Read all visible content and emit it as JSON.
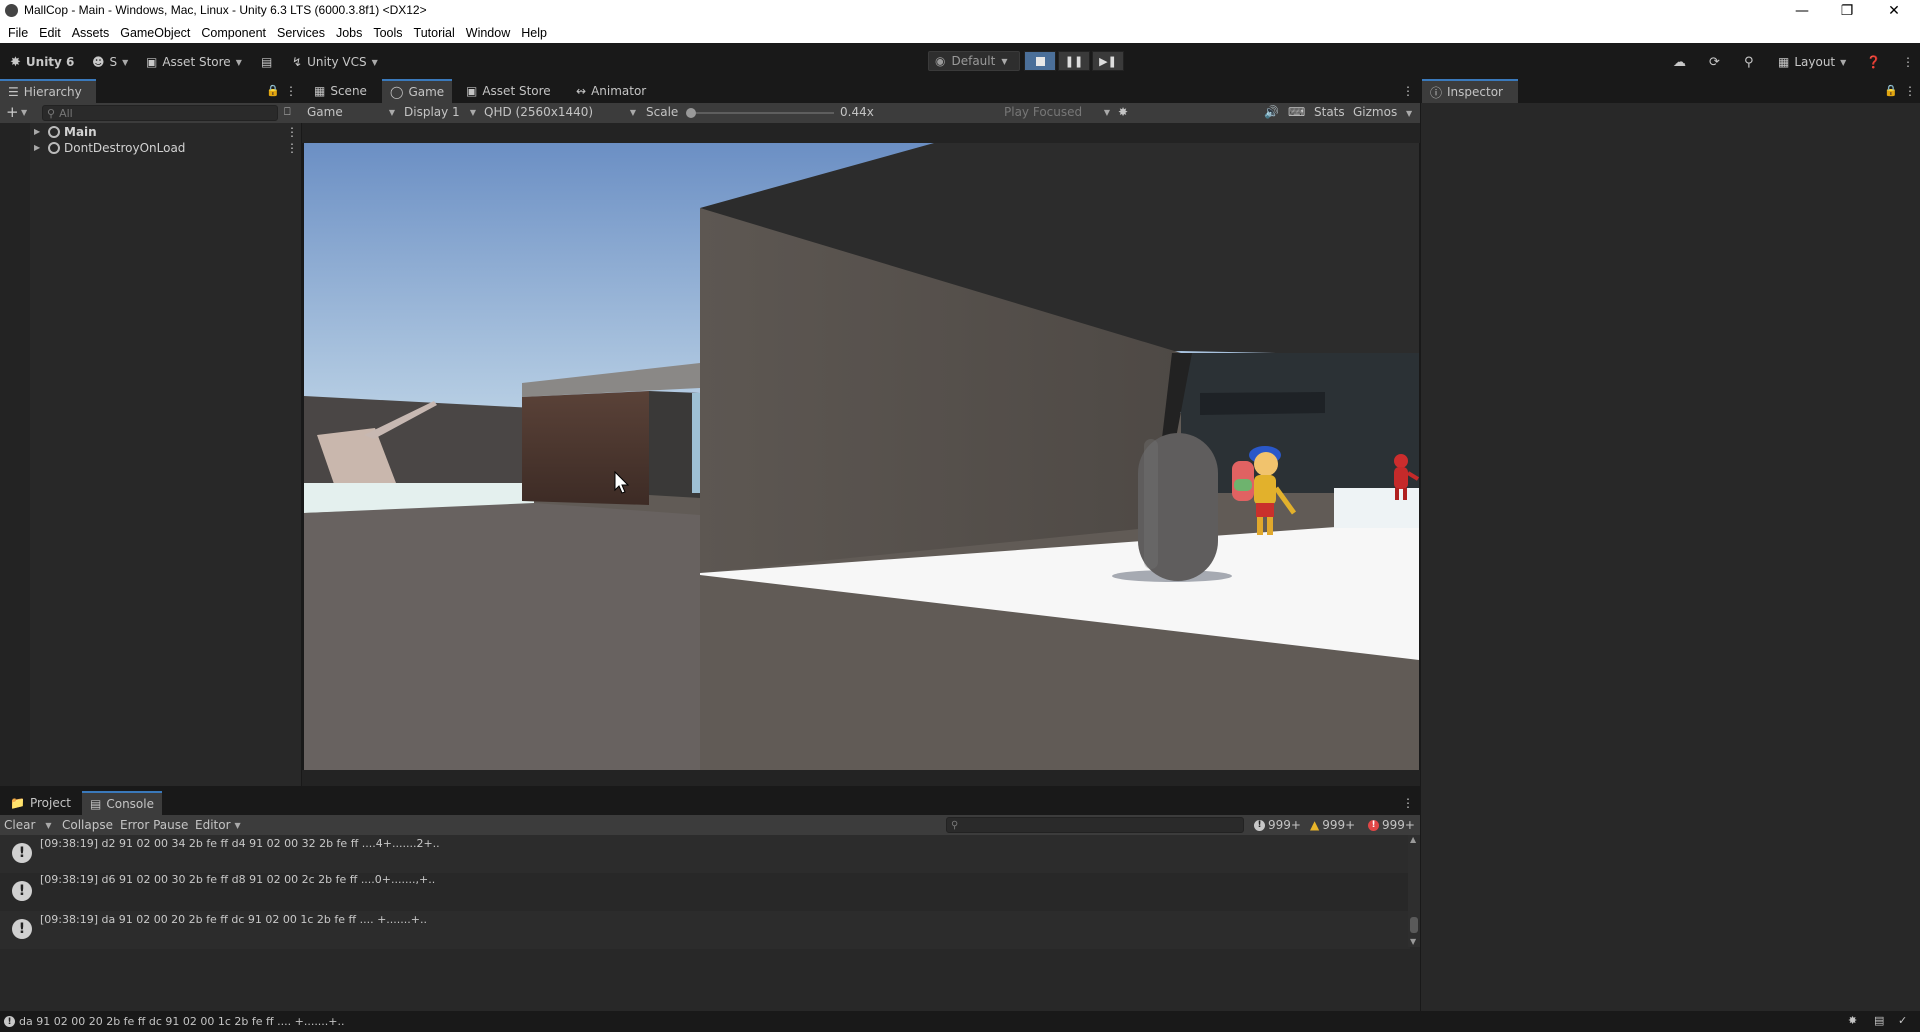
{
  "window": {
    "title": "MallCop - Main - Windows, Mac, Linux - Unity 6.3 LTS (6000.3.8f1) <DX12>",
    "minimize_icon": "minimize-icon",
    "maximize_icon": "restore-icon",
    "close_icon": "close-icon"
  },
  "menu": [
    "File",
    "Edit",
    "Assets",
    "GameObject",
    "Component",
    "Services",
    "Jobs",
    "Tools",
    "Tutorial",
    "Window",
    "Help"
  ],
  "toolbar": {
    "unity_label": "Unity 6",
    "account_label": "S",
    "asset_store_label": "Asset Store",
    "vcs_label": "Unity VCS",
    "build_profile": "Default",
    "layout_label": "Layout"
  },
  "hierarchy": {
    "tab_label": "Hierarchy",
    "search_placeholder": "All",
    "items": [
      {
        "label": "Main",
        "bold": true
      },
      {
        "label": "DontDestroyOnLoad",
        "bold": false
      }
    ]
  },
  "center_tabs": [
    "Scene",
    "Game",
    "Asset Store",
    "Animator"
  ],
  "game_bar": {
    "view_select": "Game",
    "display_select": "Display 1",
    "resolution_select": "QHD (2560x1440)",
    "scale_label": "Scale",
    "scale_value": "0.44x",
    "scale_fraction": 0.0,
    "play_mode_select": "Play Focused",
    "stats_label": "Stats",
    "gizmos_label": "Gizmos"
  },
  "inspector": {
    "tab_label": "Inspector"
  },
  "bottom_tabs": [
    "Project",
    "Console"
  ],
  "console": {
    "clear_label": "Clear",
    "collapse_label": "Collapse",
    "error_pause_label": "Error Pause",
    "editor_label": "Editor",
    "log_count": "999+",
    "warning_count": "999+",
    "error_count": "999+",
    "rows": [
      "[09:38:19] d2 91 02 00 34 2b fe ff d4 91 02 00 32 2b fe ff   ....4+.......2+..",
      "[09:38:19] d6 91 02 00 30 2b fe ff d8 91 02 00 2c 2b fe ff   ....0+.......,+..",
      "[09:38:19] da 91 02 00 20 2b fe ff dc 91 02 00 1c 2b fe ff   .... +.......+.."
    ]
  },
  "status_bar": {
    "message": "da 91 02 00 20 2b fe ff dc 91 02 00 1c 2b fe ff   .... +.......+.."
  },
  "colors": {
    "accent": "#3a79bb",
    "sky_top": "#6b8fc4",
    "sky_bottom": "#b8cfe4",
    "ground": "#615b56",
    "wall": "#58524d"
  }
}
